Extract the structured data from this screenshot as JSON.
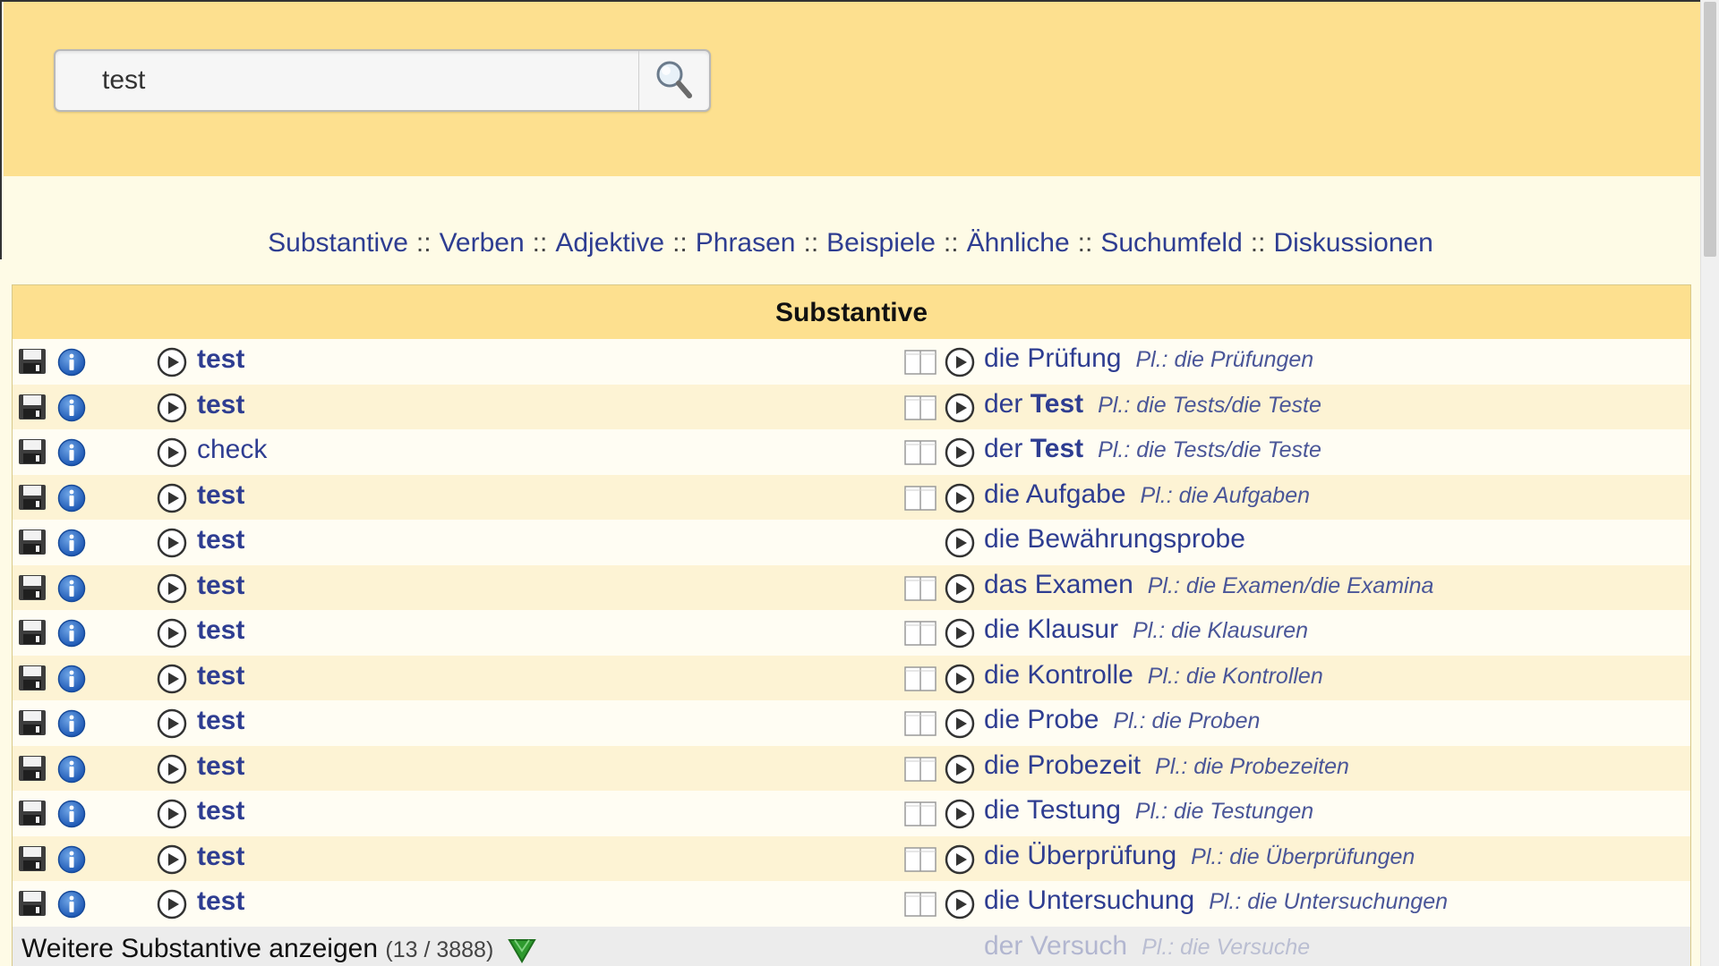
{
  "search": {
    "value": "test"
  },
  "nav": {
    "links": [
      "Substantive",
      "Verben",
      "Adjektive",
      "Phrasen",
      "Beispiele",
      "Ähnliche",
      "Suchumfeld",
      "Diskussionen"
    ],
    "separator": "::"
  },
  "table": {
    "title": "Substantive",
    "rows": [
      {
        "left": "test",
        "left_bold": true,
        "article": "die",
        "noun": "Prüfung",
        "noun_bold": false,
        "plural": "Pl.: die Prüfungen",
        "book": true
      },
      {
        "left": "test",
        "left_bold": true,
        "article": "der",
        "noun": "Test",
        "noun_bold": true,
        "plural": "Pl.: die Tests/die Teste",
        "book": true
      },
      {
        "left": "check",
        "left_bold": false,
        "article": "der",
        "noun": "Test",
        "noun_bold": true,
        "plural": "Pl.: die Tests/die Teste",
        "book": true
      },
      {
        "left": "test",
        "left_bold": true,
        "article": "die",
        "noun": "Aufgabe",
        "noun_bold": false,
        "plural": "Pl.: die Aufgaben",
        "book": true
      },
      {
        "left": "test",
        "left_bold": true,
        "article": "die",
        "noun": "Bewährungsprobe",
        "noun_bold": false,
        "plural": "",
        "book": false
      },
      {
        "left": "test",
        "left_bold": true,
        "article": "das",
        "noun": "Examen",
        "noun_bold": false,
        "plural": "Pl.: die Examen/die Examina",
        "book": true
      },
      {
        "left": "test",
        "left_bold": true,
        "article": "die",
        "noun": "Klausur",
        "noun_bold": false,
        "plural": "Pl.: die Klausuren",
        "book": true
      },
      {
        "left": "test",
        "left_bold": true,
        "article": "die",
        "noun": "Kontrolle",
        "noun_bold": false,
        "plural": "Pl.: die Kontrollen",
        "book": true
      },
      {
        "left": "test",
        "left_bold": true,
        "article": "die",
        "noun": "Probe",
        "noun_bold": false,
        "plural": "Pl.: die Proben",
        "book": true
      },
      {
        "left": "test",
        "left_bold": true,
        "article": "die",
        "noun": "Probezeit",
        "noun_bold": false,
        "plural": "Pl.: die Probezeiten",
        "book": true
      },
      {
        "left": "test",
        "left_bold": true,
        "article": "die",
        "noun": "Testung",
        "noun_bold": false,
        "plural": "Pl.: die Testungen",
        "book": true
      },
      {
        "left": "test",
        "left_bold": true,
        "article": "die",
        "noun": "Überprüfung",
        "noun_bold": false,
        "plural": "Pl.: die Überprüfungen",
        "book": true
      },
      {
        "left": "test",
        "left_bold": true,
        "article": "die",
        "noun": "Untersuchung",
        "noun_bold": false,
        "plural": "Pl.: die Untersuchungen",
        "book": true
      }
    ],
    "more": {
      "label": "Weitere Substantive anzeigen",
      "count": "(13 / 3888)",
      "faded_article": "der",
      "faded_noun": "Versuch",
      "faded_plural": "Pl.: die Versuche"
    }
  },
  "icons": {
    "save": "save-disk-icon",
    "info": "info-icon",
    "play": "play-audio-icon",
    "book": "book-icon",
    "search": "magnifier-icon",
    "more": "green-down-arrow-icon"
  },
  "colors": {
    "header_bg": "#fde08f",
    "page_bg": "#fefbe6",
    "link": "#2e3d91",
    "row_even": "#fdf3d4",
    "row_odd": "#fffdf3"
  }
}
